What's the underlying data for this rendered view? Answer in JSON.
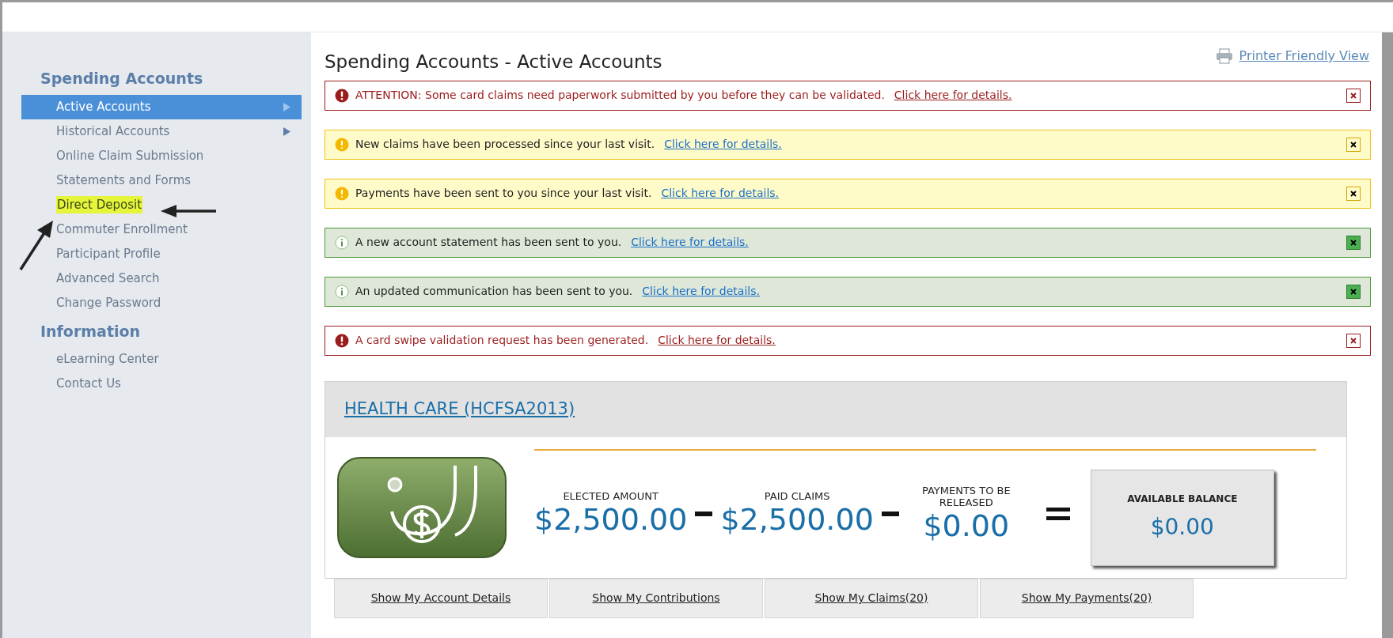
{
  "sidebar": {
    "sections": [
      {
        "heading": "Spending Accounts",
        "items": [
          {
            "label": "Active Accounts",
            "selected": true,
            "has_submenu": true,
            "highlighted": false
          },
          {
            "label": "Historical Accounts",
            "selected": false,
            "has_submenu": true,
            "highlighted": false
          },
          {
            "label": "Online Claim Submission",
            "selected": false,
            "has_submenu": false,
            "highlighted": false
          },
          {
            "label": "Statements and Forms",
            "selected": false,
            "has_submenu": false,
            "highlighted": false
          },
          {
            "label": "Direct Deposit",
            "selected": false,
            "has_submenu": false,
            "highlighted": true
          },
          {
            "label": "Commuter Enrollment",
            "selected": false,
            "has_submenu": false,
            "highlighted": false
          },
          {
            "label": "Participant Profile",
            "selected": false,
            "has_submenu": false,
            "highlighted": false
          },
          {
            "label": "Advanced Search",
            "selected": false,
            "has_submenu": false,
            "highlighted": false
          },
          {
            "label": "Change Password",
            "selected": false,
            "has_submenu": false,
            "highlighted": false
          }
        ]
      },
      {
        "heading": "Information",
        "items": [
          {
            "label": "eLearning Center",
            "selected": false,
            "has_submenu": false,
            "highlighted": false
          },
          {
            "label": "Contact Us",
            "selected": false,
            "has_submenu": false,
            "highlighted": false
          }
        ]
      }
    ]
  },
  "page_title": "Spending Accounts - Active Accounts",
  "printer_link": "Printer Friendly View",
  "alerts": [
    {
      "kind": "error",
      "message": "ATTENTION: Some card claims need paperwork submitted by you before they can be validated.",
      "link": "Click here for details."
    },
    {
      "kind": "warning",
      "message": "New claims have been processed since your last visit.",
      "link": "Click here for details."
    },
    {
      "kind": "warning",
      "message": "Payments have been sent to you since your last visit.",
      "link": "Click here for details."
    },
    {
      "kind": "info",
      "message": "A new account statement has been sent to you.",
      "link": "Click here for details."
    },
    {
      "kind": "info",
      "message": "An updated communication has been sent to you.",
      "link": "Click here for details."
    },
    {
      "kind": "error",
      "message": "A card swipe validation request has been generated.",
      "link": "Click here for details."
    }
  ],
  "account": {
    "title": "HEALTH CARE (HCFSA2013)",
    "amounts": [
      {
        "label": "ELECTED AMOUNT",
        "value": "$2,500.00"
      },
      {
        "label": "PAID CLAIMS",
        "value": "$2,500.00"
      },
      {
        "label": "PAYMENTS TO BE RELEASED",
        "value": "$0.00"
      }
    ],
    "balance": {
      "label": "AVAILABLE BALANCE",
      "value": "$0.00"
    },
    "tabs": [
      "Show My Account Details",
      "Show My Contributions",
      "Show My Claims(20)",
      "Show My Payments(20)"
    ]
  }
}
